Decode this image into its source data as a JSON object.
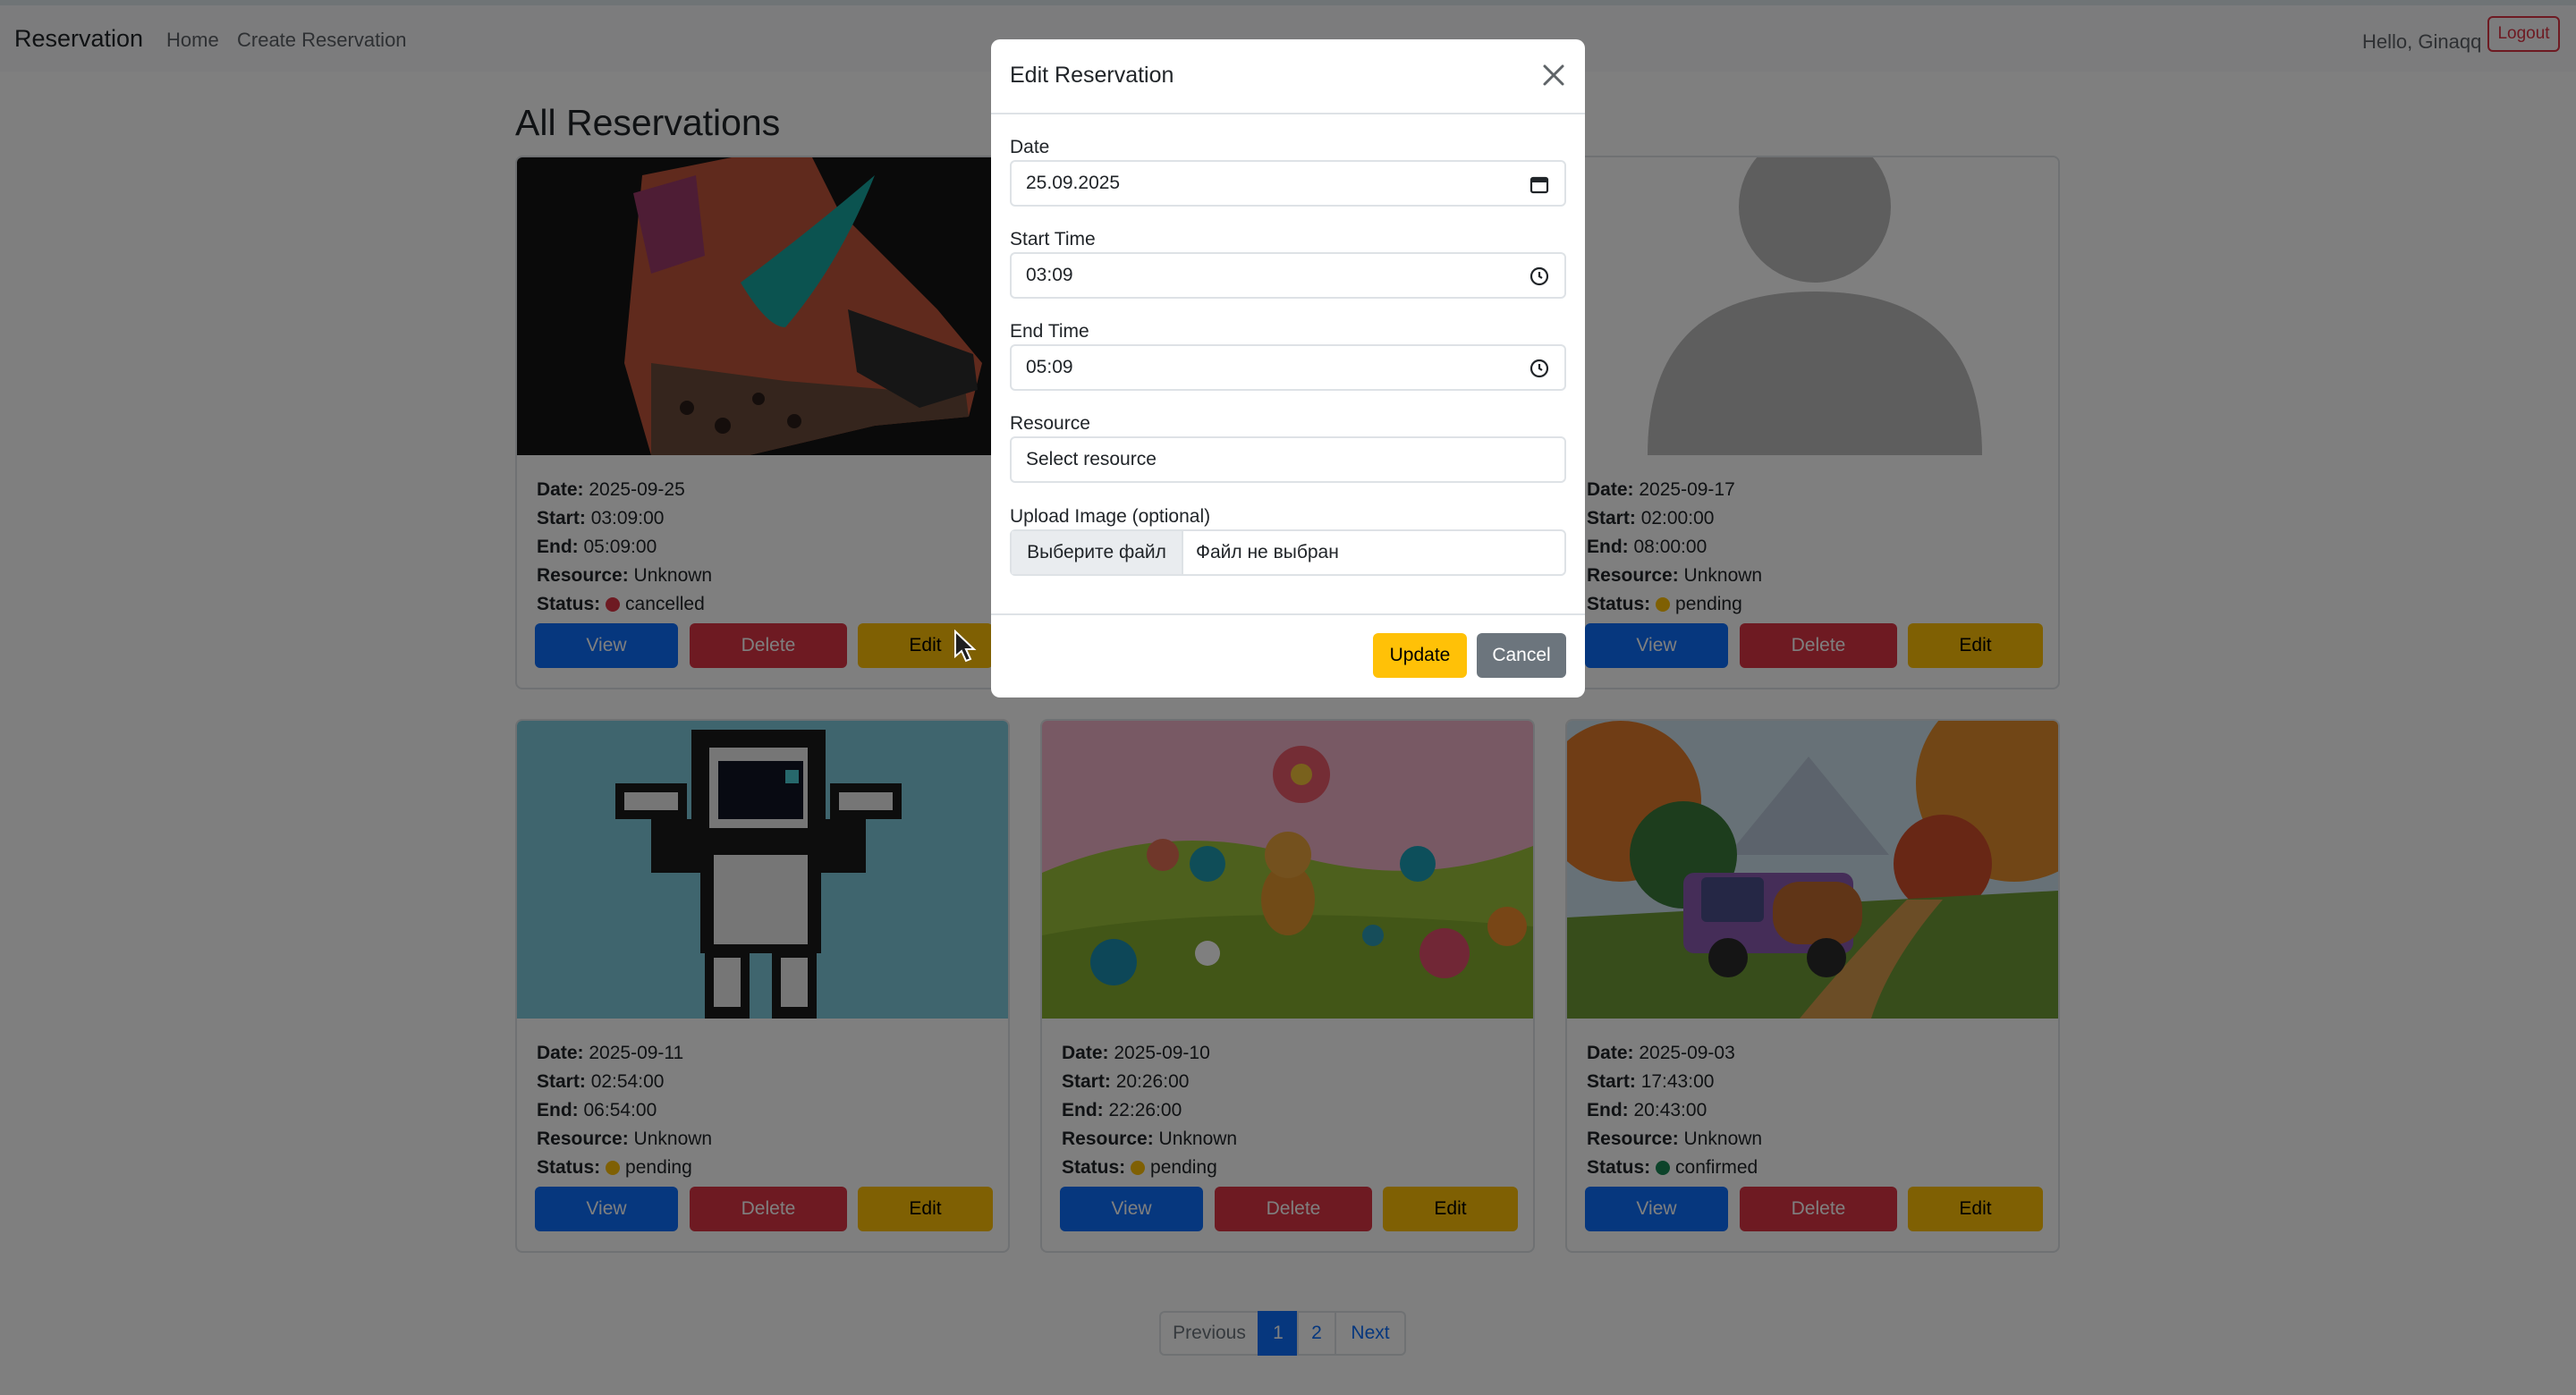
{
  "navbar": {
    "brand": "Reservation",
    "links": [
      "Home",
      "Create Reservation"
    ],
    "greeting": "Hello, Ginaqq",
    "logout_label": "Logout"
  },
  "page": {
    "title": "All Reservations"
  },
  "labels": {
    "date": "Date:",
    "start": "Start:",
    "end": "End:",
    "resource": "Resource:",
    "status": "Status:"
  },
  "card_buttons": {
    "view": "View",
    "delete": "Delete",
    "edit": "Edit"
  },
  "cards": [
    {
      "image": "sneaker-photo",
      "date": "2025-09-25",
      "start": "03:09:00",
      "end": "05:09:00",
      "resource": "Unknown",
      "status": "cancelled",
      "status_color": "#dc3545"
    },
    {
      "image": "hidden-behind-modal",
      "date": "",
      "start": "",
      "end": "",
      "resource": "",
      "status": "",
      "status_color": "#ffc107"
    },
    {
      "image": "person-placeholder",
      "date": "2025-09-17",
      "start": "02:00:00",
      "end": "08:00:00",
      "resource": "Unknown",
      "status": "pending",
      "status_color": "#ffc107"
    },
    {
      "image": "pixel-astronaut",
      "date": "2025-09-11",
      "start": "02:54:00",
      "end": "06:54:00",
      "resource": "Unknown",
      "status": "pending",
      "status_color": "#ffc107"
    },
    {
      "image": "cat-in-flower-field",
      "date": "2025-09-10",
      "start": "20:26:00",
      "end": "22:26:00",
      "resource": "Unknown",
      "status": "pending",
      "status_color": "#ffc107"
    },
    {
      "image": "purple-truck-autumn",
      "date": "2025-09-03",
      "start": "17:43:00",
      "end": "20:43:00",
      "resource": "Unknown",
      "status": "confirmed",
      "status_color": "#198754"
    }
  ],
  "pagination": {
    "previous": "Previous",
    "pages": [
      "1",
      "2"
    ],
    "active": "1",
    "next": "Next"
  },
  "modal": {
    "title": "Edit Reservation",
    "date_label": "Date",
    "date_value": "25.09.2025",
    "start_label": "Start Time",
    "start_value": "03:09",
    "end_label": "End Time",
    "end_value": "05:09",
    "resource_label": "Resource",
    "resource_placeholder": "Select resource",
    "upload_label": "Upload Image (optional)",
    "file_button": "Выберите файл",
    "file_status": "Файл не выбран",
    "update_label": "Update",
    "cancel_label": "Cancel"
  },
  "colors": {
    "primary": "#0d6efd",
    "danger": "#dc3545",
    "warning": "#ffc107",
    "secondary": "#6c757d",
    "success": "#198754"
  }
}
